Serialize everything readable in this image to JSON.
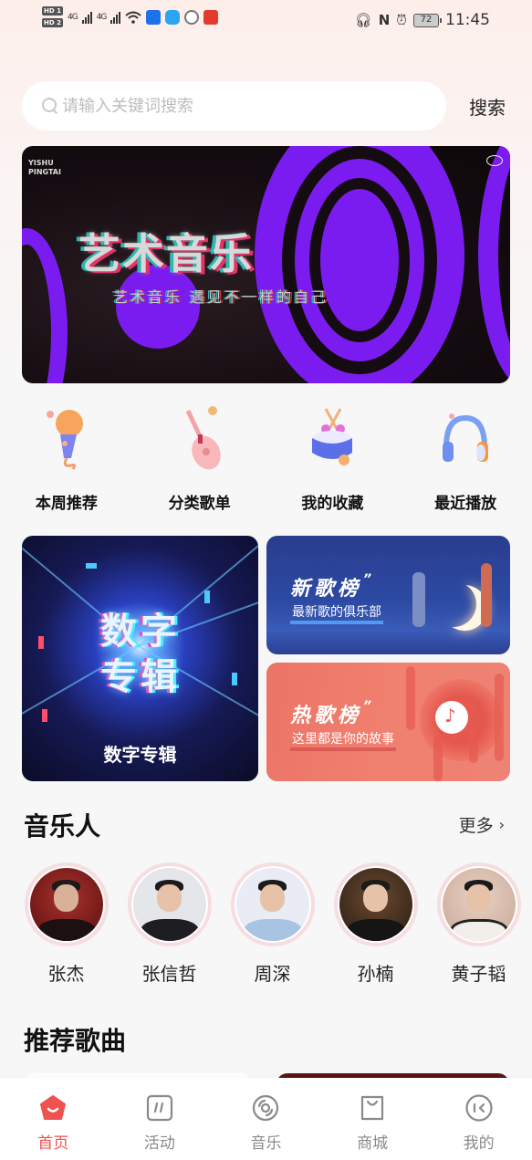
{
  "status_bar": {
    "sim_labels": [
      "HD 1",
      "HD 2"
    ],
    "network": [
      "4G",
      "4G"
    ],
    "battery": "72",
    "time": "11:45",
    "icons": [
      "signal-icon",
      "wifi-icon",
      "app-notification-icon",
      "search-app-icon",
      "shield-app-icon",
      "red-app-icon",
      "headphones-icon",
      "nfc-icon",
      "alarm-icon",
      "battery-icon"
    ]
  },
  "search": {
    "placeholder": "请输入关键词搜索",
    "value": "",
    "button_label": "搜索"
  },
  "banner": {
    "tag_line1": "YISHU",
    "tag_line2": "PINGTAI",
    "title": "艺术音乐",
    "subtitle": "艺术音乐 遇见不一样的自己"
  },
  "categories": [
    {
      "label": "本周推荐",
      "icon": "microphone-icon"
    },
    {
      "label": "分类歌单",
      "icon": "guitar-icon"
    },
    {
      "label": "我的收藏",
      "icon": "drum-icon"
    },
    {
      "label": "最近播放",
      "icon": "headphones-icon"
    }
  ],
  "feature_cards": {
    "digital_album": {
      "overlay_text": "数字专辑",
      "label": "数字专辑"
    },
    "new_songs": {
      "title": "新歌榜",
      "subtitle": "最新歌的俱乐部"
    },
    "hot_songs": {
      "title": "热歌榜",
      "subtitle": "这里都是你的故事"
    }
  },
  "musicians": {
    "title": "音乐人",
    "more_label": "更多",
    "items": [
      {
        "name": "张杰"
      },
      {
        "name": "张信哲"
      },
      {
        "name": "周深"
      },
      {
        "name": "孙楠"
      },
      {
        "name": "黄子韬"
      }
    ]
  },
  "recommended": {
    "title": "推荐歌曲"
  },
  "bottom_nav": {
    "items": [
      {
        "label": "首页",
        "icon": "home-icon",
        "active": true
      },
      {
        "label": "活动",
        "icon": "activity-icon",
        "active": false
      },
      {
        "label": "音乐",
        "icon": "music-disc-icon",
        "active": false
      },
      {
        "label": "商城",
        "icon": "shopping-bag-icon",
        "active": false
      },
      {
        "label": "我的",
        "icon": "profile-icon",
        "active": false
      }
    ]
  },
  "colors": {
    "accent": "#f0524f",
    "nav_inactive": "#8a8a8a",
    "banner_purple": "#7a1cf0"
  }
}
